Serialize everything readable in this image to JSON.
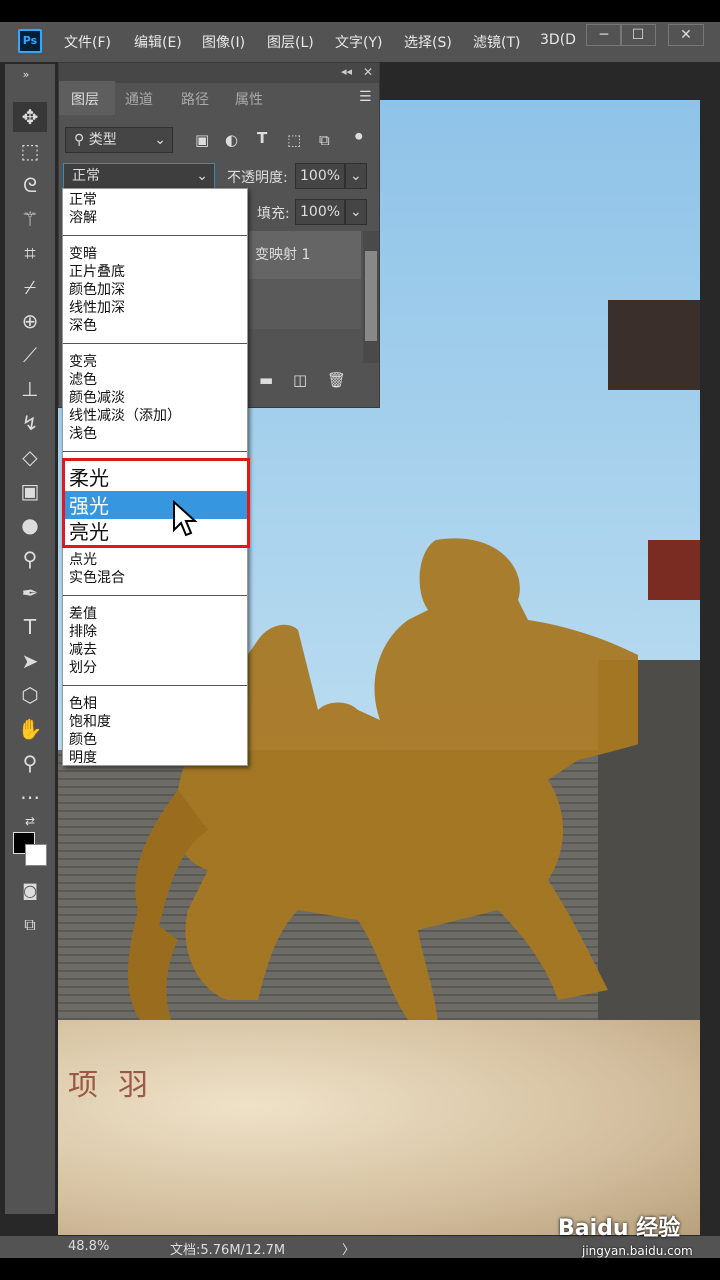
{
  "app": {
    "logo": "Ps"
  },
  "menubar": {
    "items": [
      "文件(F)",
      "编辑(E)",
      "图像(I)",
      "图层(L)",
      "文字(Y)",
      "选择(S)",
      "滤镜(T)",
      "3D(D"
    ],
    "window_buttons": [
      "─",
      "☐",
      "✕"
    ]
  },
  "panel": {
    "header_controls": [
      "»",
      "◂◂",
      "✕"
    ],
    "tabs": [
      "图层",
      "通道",
      "路径",
      "属性"
    ],
    "menu_icon": "hamburger-icon",
    "filter_label": "类型",
    "blend_mode": "正常",
    "opacity_label": "不透明度:",
    "opacity_value": "100%",
    "fill_label": "填充:",
    "fill_value": "100%",
    "layer_name": "变映射 1"
  },
  "blend_modes": {
    "group1": [
      "正常",
      "溶解"
    ],
    "group2": [
      "变暗",
      "正片叠底",
      "颜色加深",
      "线性加深",
      "深色"
    ],
    "group3": [
      "变亮",
      "滤色",
      "颜色减淡",
      "线性减淡（添加）",
      "浅色"
    ],
    "group4": [
      "柔光",
      "强光",
      "亮光",
      "点光",
      "实色混合"
    ],
    "group5": [
      "差值",
      "排除",
      "减去",
      "划分"
    ],
    "group6": [
      "色相",
      "饱和度",
      "颜色",
      "明度"
    ],
    "highlighted": "强光"
  },
  "image": {
    "rock_inscription": "项羽"
  },
  "status": {
    "zoom": "48.8%",
    "doc": "文档:5.76M/12.7M",
    "arrow": "〉"
  },
  "watermark": {
    "brand": "Baidu 经验",
    "url": "jingyan.baidu.com"
  },
  "colors": {
    "accent": "#31a8ff",
    "highlight": "#3796e0",
    "annotation": "#e01818",
    "statue": "#a87822"
  }
}
